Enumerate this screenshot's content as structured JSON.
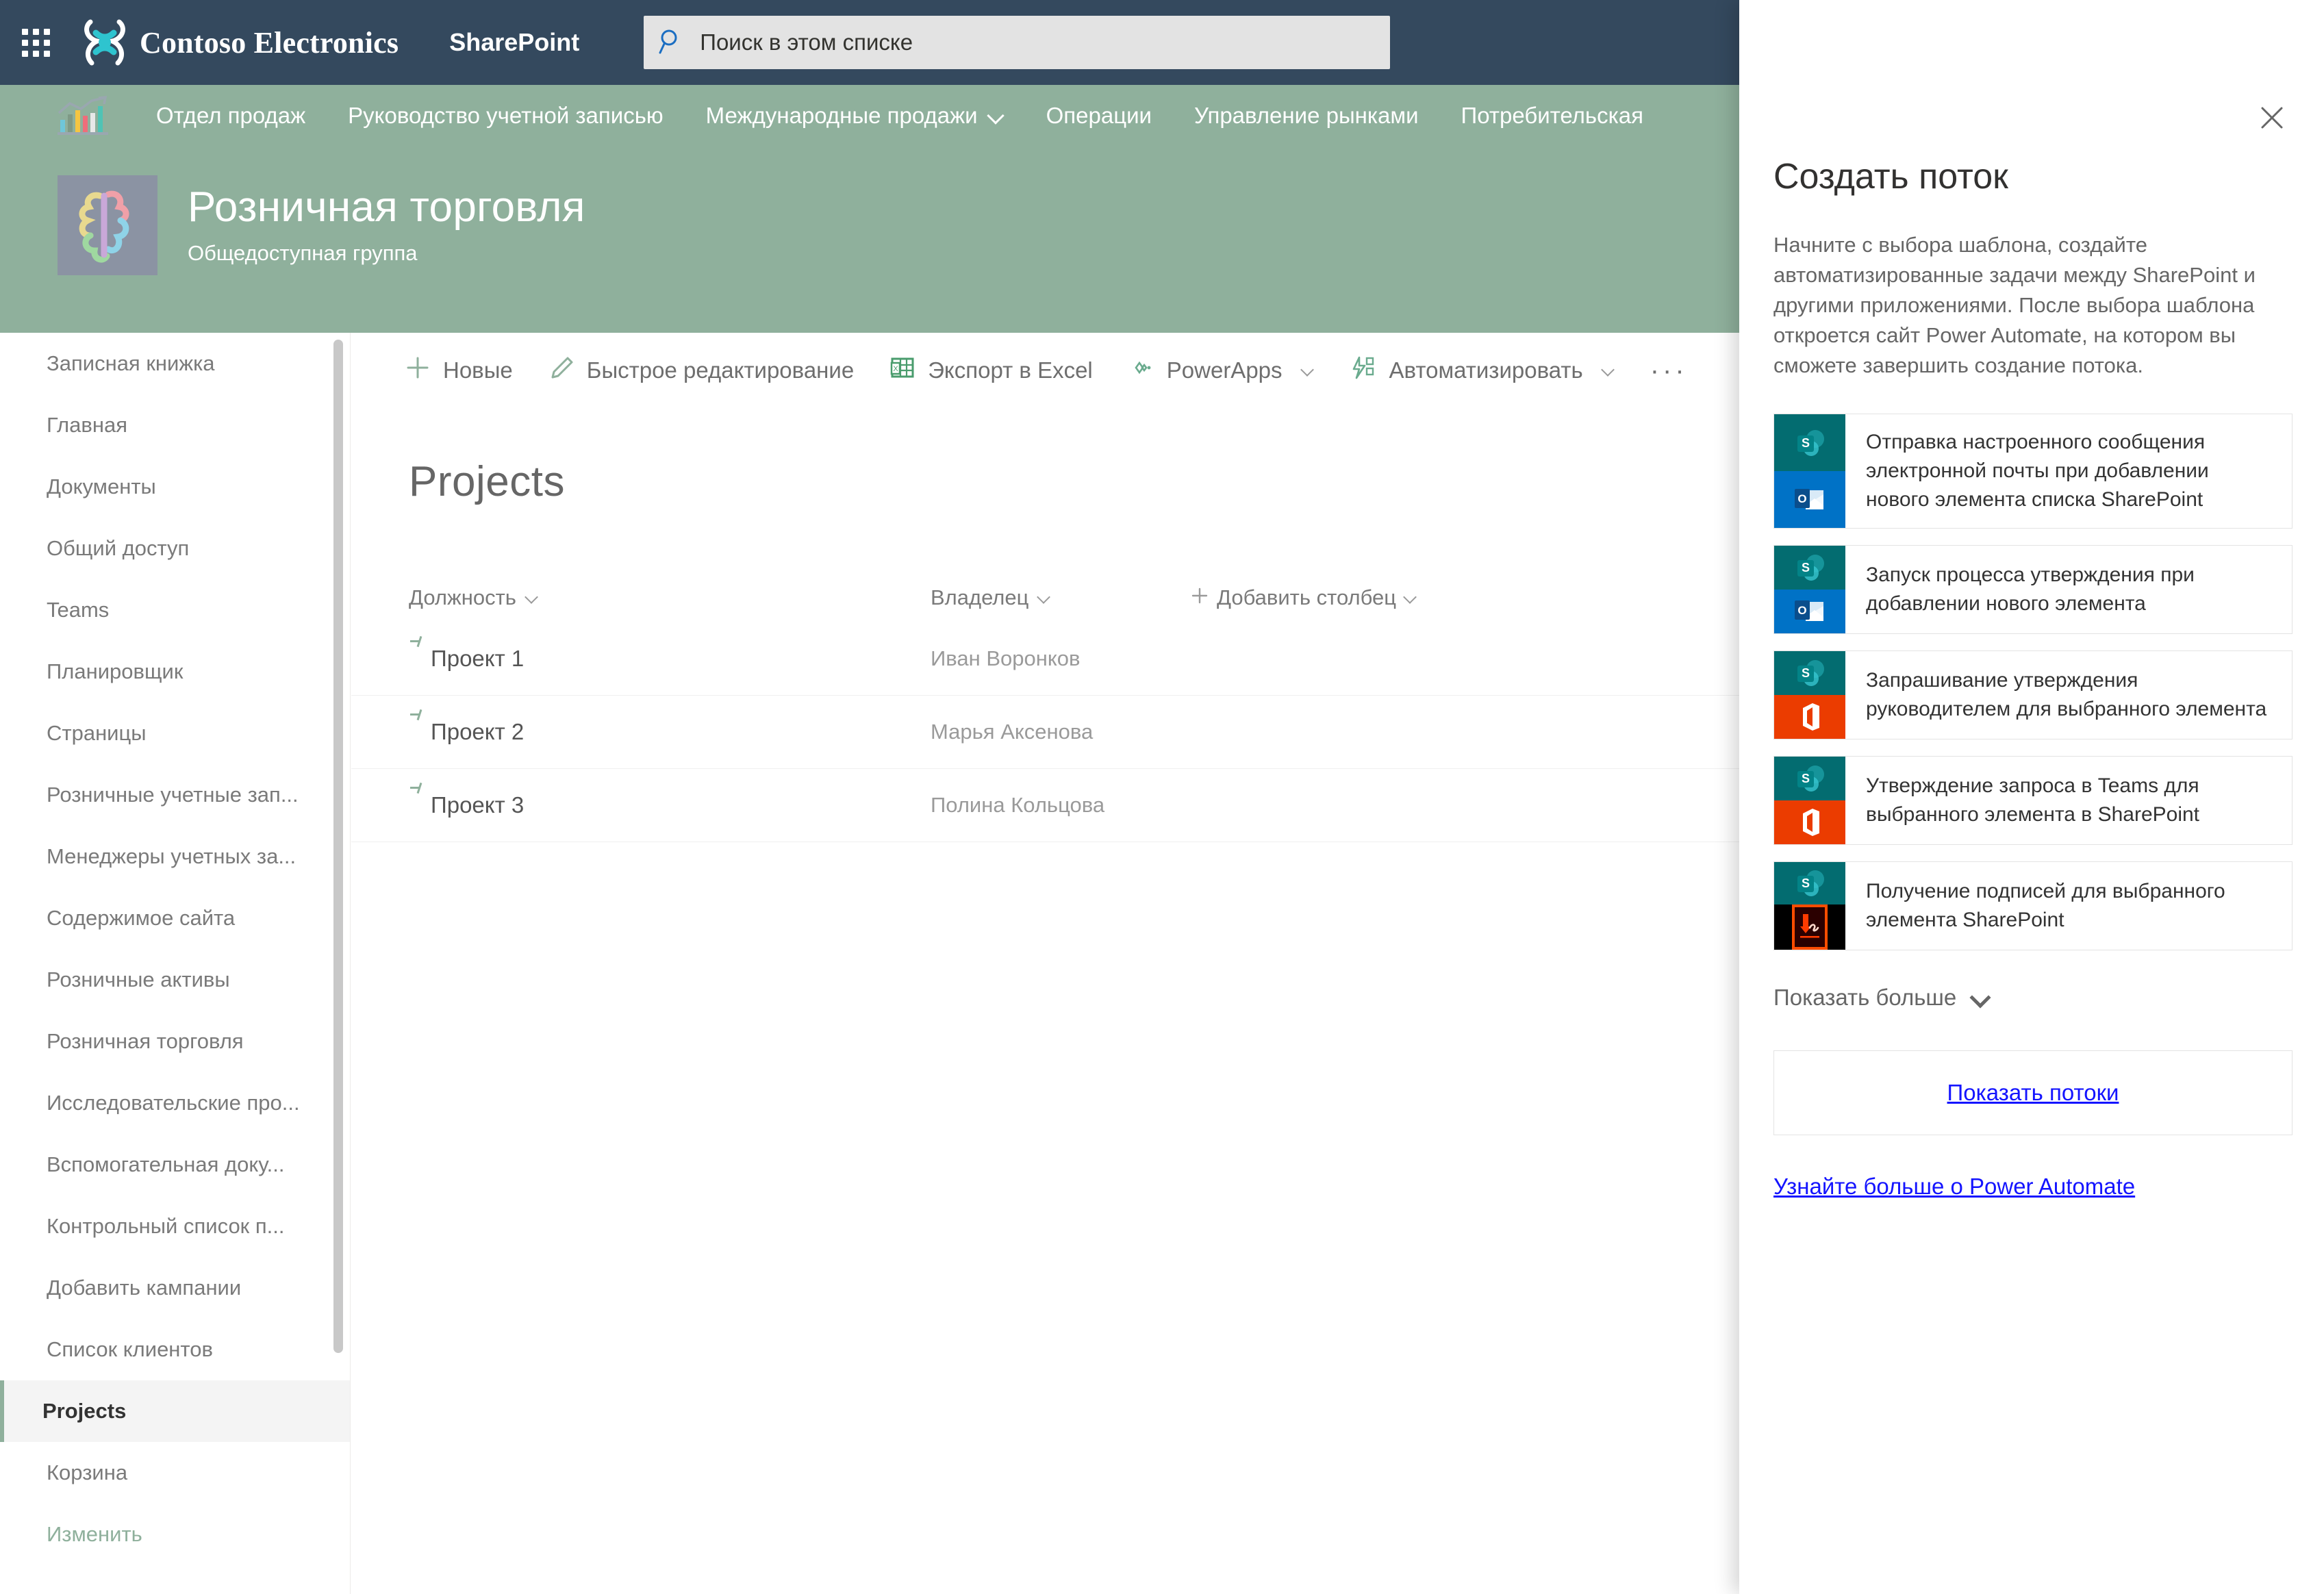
{
  "suite": {
    "waffle_label": "app-launcher",
    "brand": "Contoso Electronics",
    "app": "SharePoint",
    "search_placeholder": "Поиск в этом списке",
    "search_value": "",
    "icons": [
      "megaphone-icon",
      "bell-icon",
      "gear-icon",
      "help-icon",
      "avatar"
    ]
  },
  "site_nav": {
    "items": [
      {
        "label": "Отдел продаж",
        "has_chevron": false
      },
      {
        "label": "Руководство учетной записью",
        "has_chevron": false
      },
      {
        "label": "Международные продажи",
        "has_chevron": true
      },
      {
        "label": "Операции",
        "has_chevron": false
      },
      {
        "label": "Управление рынками",
        "has_chevron": false
      },
      {
        "label": "Потребительская",
        "has_chevron": false
      }
    ]
  },
  "site_header": {
    "title": "Розничная торговля",
    "subtitle": "Общедоступная группа"
  },
  "left_nav": {
    "items": [
      {
        "label": "Записная книжка",
        "selected": false,
        "style": "normal"
      },
      {
        "label": "Главная",
        "selected": false,
        "style": "normal"
      },
      {
        "label": "Документы",
        "selected": false,
        "style": "normal"
      },
      {
        "label": "Общий доступ",
        "selected": false,
        "style": "normal"
      },
      {
        "label": "Teams",
        "selected": false,
        "style": "normal"
      },
      {
        "label": "Планировщик",
        "selected": false,
        "style": "normal"
      },
      {
        "label": "Страницы",
        "selected": false,
        "style": "normal"
      },
      {
        "label": "Розничные учетные зап...",
        "selected": false,
        "style": "normal"
      },
      {
        "label": "Менеджеры учетных за...",
        "selected": false,
        "style": "normal"
      },
      {
        "label": "Содержимое сайта",
        "selected": false,
        "style": "normal"
      },
      {
        "label": "Розничные активы",
        "selected": false,
        "style": "normal"
      },
      {
        "label": "Розничная торговля",
        "selected": false,
        "style": "normal"
      },
      {
        "label": "Исследовательские про...",
        "selected": false,
        "style": "normal"
      },
      {
        "label": "Вспомогательная доку...",
        "selected": false,
        "style": "normal"
      },
      {
        "label": "Контрольный список п...",
        "selected": false,
        "style": "normal"
      },
      {
        "label": "Добавить кампании",
        "selected": false,
        "style": "normal"
      },
      {
        "label": "Список клиентов",
        "selected": false,
        "style": "normal"
      },
      {
        "label": "Projects",
        "selected": true,
        "style": "normal"
      },
      {
        "label": "Корзина",
        "selected": false,
        "style": "normal"
      },
      {
        "label": "Изменить",
        "selected": false,
        "style": "edit"
      }
    ]
  },
  "command_bar": {
    "items": [
      {
        "label": "Новые",
        "icon": "plus-icon",
        "chevron": false
      },
      {
        "label": "Быстрое редактирование",
        "icon": "pencil-icon",
        "chevron": false
      },
      {
        "label": "Экспорт в Excel",
        "icon": "excel-icon",
        "chevron": false
      },
      {
        "label": "PowerApps",
        "icon": "powerapps-icon",
        "chevron": true
      },
      {
        "label": "Автоматизировать",
        "icon": "flow-icon",
        "chevron": true
      }
    ],
    "overflow": "···"
  },
  "list": {
    "title": "Projects",
    "columns": [
      {
        "label": "Должность",
        "chevron": true
      },
      {
        "label": "Владелец",
        "chevron": true
      },
      {
        "label": "Добавить столбец",
        "chevron": true,
        "plus": true
      }
    ],
    "rows": [
      {
        "title": "Проект 1",
        "owner": "Иван Воронков"
      },
      {
        "title": "Проект 2",
        "owner": "Марья Аксенова"
      },
      {
        "title": "Проект 3",
        "owner": "Полина Кольцова"
      }
    ]
  },
  "panel": {
    "close_label": "close-icon",
    "title": "Создать поток",
    "description": "Начните с выбора шаблона, создайте автоматизированные задачи между SharePoint и другими приложениями. После выбора шаблона откроется сайт Power Automate, на котором вы сможете завершить создание потока.",
    "templates": [
      {
        "label": "Отправка настроенного сообщения электронной почты при добавлении нового элемента списка SharePoint",
        "icon_top": "sharepoint-icon",
        "icon_bottom": "outlook-icon"
      },
      {
        "label": "Запуск процесса утверждения при добавлении нового элемента",
        "icon_top": "sharepoint-icon",
        "icon_bottom": "outlook-icon"
      },
      {
        "label": "Запрашивание утверждения руководителем для выбранного элемента",
        "icon_top": "sharepoint-icon",
        "icon_bottom": "office365-icon"
      },
      {
        "label": "Утверждение запроса в Teams для выбранного элемента в SharePoint",
        "icon_top": "sharepoint-icon",
        "icon_bottom": "office365-icon"
      },
      {
        "label": "Получение подписей для выбранного элемента SharePoint",
        "icon_top": "sharepoint-icon",
        "icon_bottom": "adobe-sign-icon"
      }
    ],
    "show_more": "Показать больше",
    "show_flows": "Показать потоки",
    "learn_more": "Узнайте больше о Power Automate"
  },
  "colors": {
    "suite_bar": "#34495e",
    "site_theme": "#8fb09c",
    "sharepoint_teal": "#036c70",
    "outlook_blue": "#0072c6",
    "office_orange": "#eb3c00",
    "link_blue": "#1414ff"
  }
}
